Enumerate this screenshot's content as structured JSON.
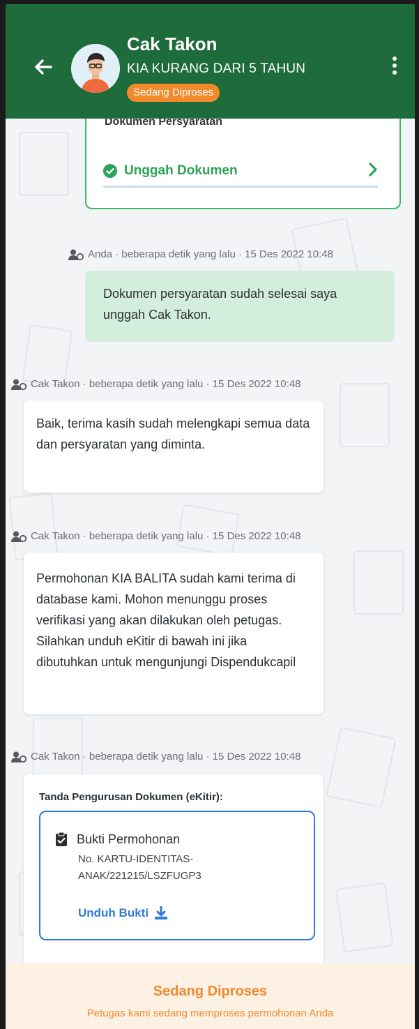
{
  "header": {
    "title": "Cak Takon",
    "subtitle": "KIA KURANG DARI 5 TAHUN",
    "status_badge": "Sedang Diproses"
  },
  "document_card": {
    "label": "Dokumen Persyaratan",
    "upload_label": "Unggah Dokumen"
  },
  "messages": [
    {
      "sender": "Anda",
      "meta": "Anda · beberapa detik yang lalu · 15 Des 2022 10:48",
      "text": "Dokumen persyaratan sudah selesai saya unggah Cak Takon."
    },
    {
      "sender": "Cak Takon",
      "meta": "Cak Takon · beberapa detik yang lalu · 15 Des 2022 10:48",
      "text": "Baik, terima kasih sudah melengkapi semua data dan persyaratan yang diminta."
    },
    {
      "sender": "Cak Takon",
      "meta": "Cak Takon · beberapa detik yang lalu · 15 Des 2022 10:48",
      "text": "Permohonan KIA BALITA sudah kami terima di database kami. Mohon menunggu proses verifikasi yang akan dilakukan oleh petugas. Silahkan unduh eKitir di bawah ini jika dibutuhkan untuk mengunjungi Dispendukcapil"
    },
    {
      "sender": "Cak Takon",
      "meta": "Cak Takon · beberapa detik yang lalu · 15 Des 2022 10:48"
    }
  ],
  "ekitir": {
    "title": "Tanda Pengurusan Dokumen (eKitir):",
    "proof_title": "Bukti Permohonan",
    "proof_number": "No. KARTU-IDENTITAS-ANAK/221215/LSZFUGP3",
    "download_label": "Unduh Bukti"
  },
  "footer": {
    "title": "Sedang Diproses",
    "subtitle": "Petugas kami sedang memproses permohonan Anda"
  },
  "colors": {
    "header_bg": "#1e6b3b",
    "badge": "#f08a2a",
    "success_green": "#2ea357",
    "link_blue": "#2f7ad6",
    "my_bubble": "#d3eedc",
    "footer_bg": "#fdf1e4",
    "footer_text": "#ef8a2f"
  },
  "icons": {
    "back": "arrow-left-icon",
    "menu": "kebab-menu-icon",
    "upload_status": "check-circle-icon",
    "upload_chevron": "chevron-right-icon",
    "sender": "user-icon",
    "proof": "clipboard-check-icon",
    "download": "download-icon"
  }
}
